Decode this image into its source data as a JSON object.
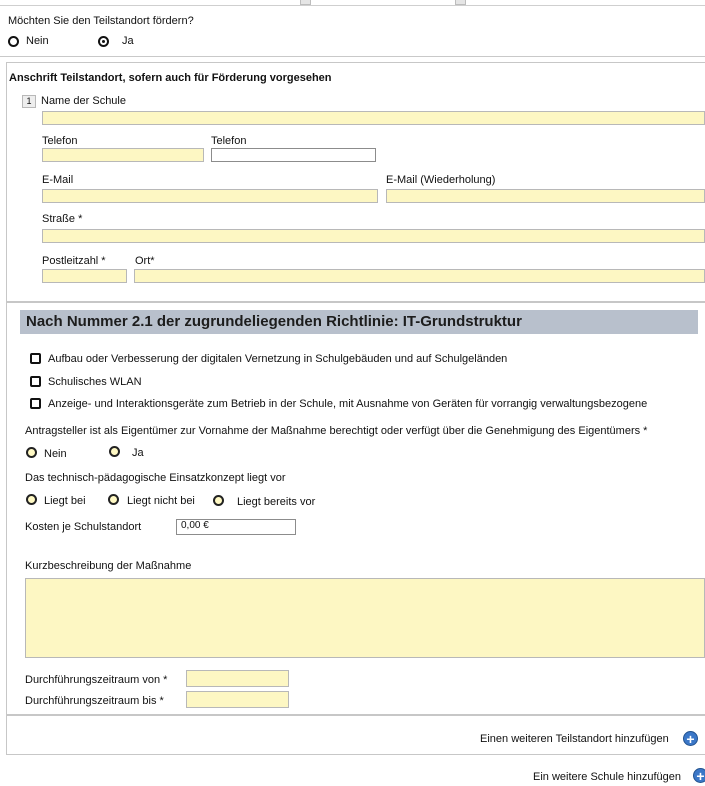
{
  "q_foerdern": {
    "question": "Möchten Sie den Teilstandort fördern?",
    "opt_nein": "Nein",
    "opt_ja": "Ja",
    "selected": "Ja"
  },
  "anschrift": {
    "heading": "Anschrift Teilstandort, sofern auch für Förderung vorgesehen",
    "index": "1",
    "name_label": "Name der Schule",
    "telefon1_label": "Telefon",
    "telefon2_label": "Telefon",
    "email_label": "E-Mail",
    "email_repeat_label": "E-Mail (Wiederholung)",
    "strasse_label": "Straße *",
    "plz_label": "Postleitzahl *",
    "ort_label": "Ort*"
  },
  "section": {
    "title": "Nach Nummer 2.1 der zugrundeliegenden Richtlinie: IT-Grundstruktur",
    "checkboxes": [
      "Aufbau oder Verbesserung der digitalen Vernetzung in Schulgebäuden und auf Schulgeländen",
      "Schulisches WLAN",
      "Anzeige- und Interaktionsgeräte zum Betrieb in der Schule, mit Ausnahme von Geräten für vorrangig verwaltungsbezogene"
    ],
    "eigentuemer_question": "Antragsteller ist als Eigentümer zur Vornahme der Maßnahme berechtigt oder verfügt über die Genehmigung des Eigentümers *",
    "eigentuemer_nein": "Nein",
    "eigentuemer_ja": "Ja",
    "konzept_question": "Das technisch-pädagogische Einsatzkonzept liegt vor",
    "konzept_opt1": "Liegt bei",
    "konzept_opt2": "Liegt nicht bei",
    "konzept_opt3": "Liegt bereits vor",
    "kosten_label": "Kosten je Schulstandort",
    "kosten_value": "0,00 €",
    "kurz_label": "Kurzbeschreibung der Maßnahme",
    "zeitraum_von_label": "Durchführungszeitraum von *",
    "zeitraum_bis_label": "Durchführungszeitraum bis *"
  },
  "footer": {
    "add_teilstandort": "Einen weiteren Teilstandort hinzufügen",
    "add_schule": "Ein weitere Schule hinzufügen"
  },
  "colors": {
    "field_yellow": "#fdf7c3",
    "section_bar": "#b8c0cc",
    "plus_blue": "#3b77c7"
  }
}
